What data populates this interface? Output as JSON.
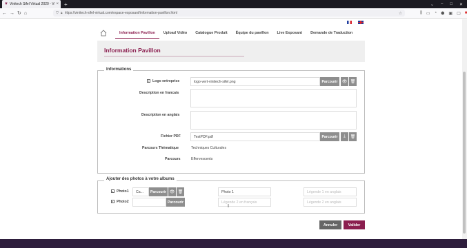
{
  "browser": {
    "tab_title": "Vinitech Sifel Virtual 2020 - Vin...",
    "url": "https://vinitech-sifel-virtual.com/espace-exposant/information-pavillon.html"
  },
  "header": {
    "tabs": [
      {
        "label": "Information Pavillon",
        "active": true
      },
      {
        "label": "Upload Vidéo"
      },
      {
        "label": "Catalogue Produit"
      },
      {
        "label": "Équipe du pavillon"
      },
      {
        "label": "Live Exposant"
      },
      {
        "label": "Demande de Traduction"
      }
    ]
  },
  "page": {
    "title": "Information Pavillon"
  },
  "informations": {
    "legend": "Informations",
    "logo_label": "Logo entreprise",
    "logo_value": "logo-vert-vinitech-sifel.png",
    "desc_fr_label": "Description en francais",
    "desc_en_label": "Description en anglais",
    "pdf_label": "Fichier PDF",
    "pdf_value": "TestPDF.pdf",
    "parcours_thematique_label": "Parcours Thématique",
    "parcours_thematique_value": "Techniques Culturales",
    "parcours_label": "Parcours",
    "parcours_value": "Effervescents",
    "browse_label": "Parcourir"
  },
  "photos": {
    "legend": "Ajouter des photos à votre albums",
    "photo1_label": "Photo1",
    "photo1_file": "Ca...",
    "photo1_title_fr": "Photo 1",
    "photo1_title_en_placeholder": "Légende 1 en anglais",
    "photo2_label": "Photo2",
    "photo2_title_fr_placeholder": "Légende 2 en français",
    "photo2_title_en_placeholder": "Légende 2 en anglais",
    "browse_label": "Parcourir"
  },
  "actions": {
    "cancel": "Annuler",
    "submit": "Valider"
  },
  "colors": {
    "accent": "#8b1e4f",
    "footer": "#2e1e3d"
  }
}
